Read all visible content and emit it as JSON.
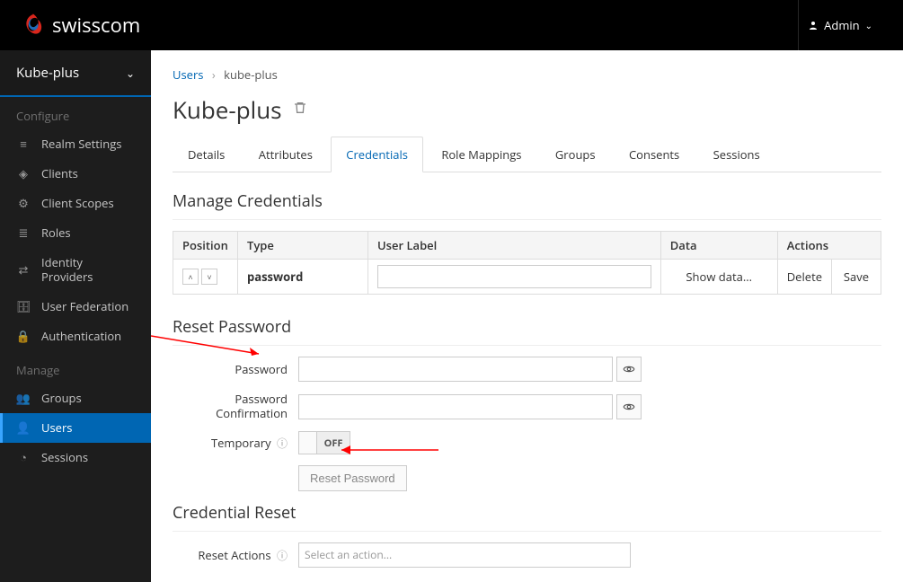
{
  "header": {
    "brand": "swisscom",
    "user": "Admin"
  },
  "sidebar": {
    "realm": "Kube-plus",
    "section_configure": "Configure",
    "section_manage": "Manage",
    "items_configure": [
      {
        "label": "Realm Settings"
      },
      {
        "label": "Clients"
      },
      {
        "label": "Client Scopes"
      },
      {
        "label": "Roles"
      },
      {
        "label": "Identity Providers"
      },
      {
        "label": "User Federation"
      },
      {
        "label": "Authentication"
      }
    ],
    "items_manage": [
      {
        "label": "Groups"
      },
      {
        "label": "Users"
      },
      {
        "label": "Sessions"
      }
    ]
  },
  "breadcrumb": {
    "root": "Users",
    "current": "kube-plus"
  },
  "page_title": "Kube-plus",
  "tabs": [
    "Details",
    "Attributes",
    "Credentials",
    "Role Mappings",
    "Groups",
    "Consents",
    "Sessions"
  ],
  "active_tab": "Credentials",
  "sections": {
    "manage_credentials": "Manage Credentials",
    "reset_password": "Reset Password",
    "credential_reset": "Credential Reset"
  },
  "cred_table": {
    "headers": {
      "position": "Position",
      "type": "Type",
      "user_label": "User Label",
      "data": "Data",
      "actions": "Actions"
    },
    "row": {
      "type": "password",
      "show_data": "Show data...",
      "delete": "Delete",
      "save": "Save"
    }
  },
  "form": {
    "password_label": "Password",
    "password_confirm_label": "Password Confirmation",
    "temporary_label": "Temporary",
    "toggle_off": "OFF",
    "reset_btn": "Reset Password",
    "reset_actions_label": "Reset Actions",
    "select_placeholder": "Select an action..."
  }
}
